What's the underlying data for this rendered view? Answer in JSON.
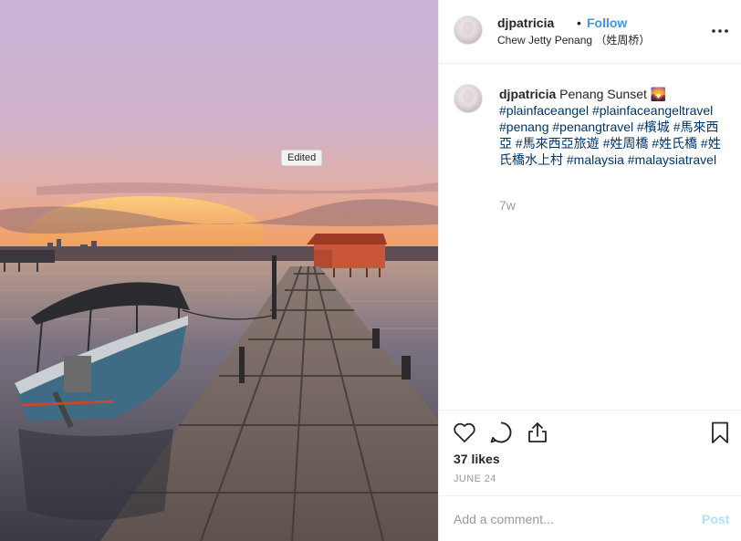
{
  "photo": {
    "alt": "",
    "edited_tag": "Edited"
  },
  "post": {
    "username": "djpatricia",
    "separator": "•",
    "follow_label": "Follow",
    "location": "Chew Jetty Penang （姓周桥）",
    "more_icon": "more-horizontal-icon"
  },
  "caption": {
    "username": "djpatricia",
    "text": " Penang Sunset 🌄",
    "hashtags": "#plainfaceangel #plainfaceangeltravel #penang #penangtravel #檳城 #馬來西亞 #馬來西亞旅遊 #姓周橋 #姓氏橋 #姓氏橋水上村 #malaysia #malaysiatravel",
    "age": "7w"
  },
  "actions": {
    "like_icon": "heart-icon",
    "comment_icon": "comment-icon",
    "share_icon": "share-icon",
    "save_icon": "bookmark-icon"
  },
  "stats": {
    "likes": "37 likes",
    "date": "JUNE 24"
  },
  "add_comment": {
    "placeholder": "Add a comment...",
    "post_label": "Post"
  },
  "colors": {
    "accent": "#3897f0",
    "hashtag": "#003569",
    "muted": "#999999",
    "post_disabled": "#b2dffc"
  }
}
